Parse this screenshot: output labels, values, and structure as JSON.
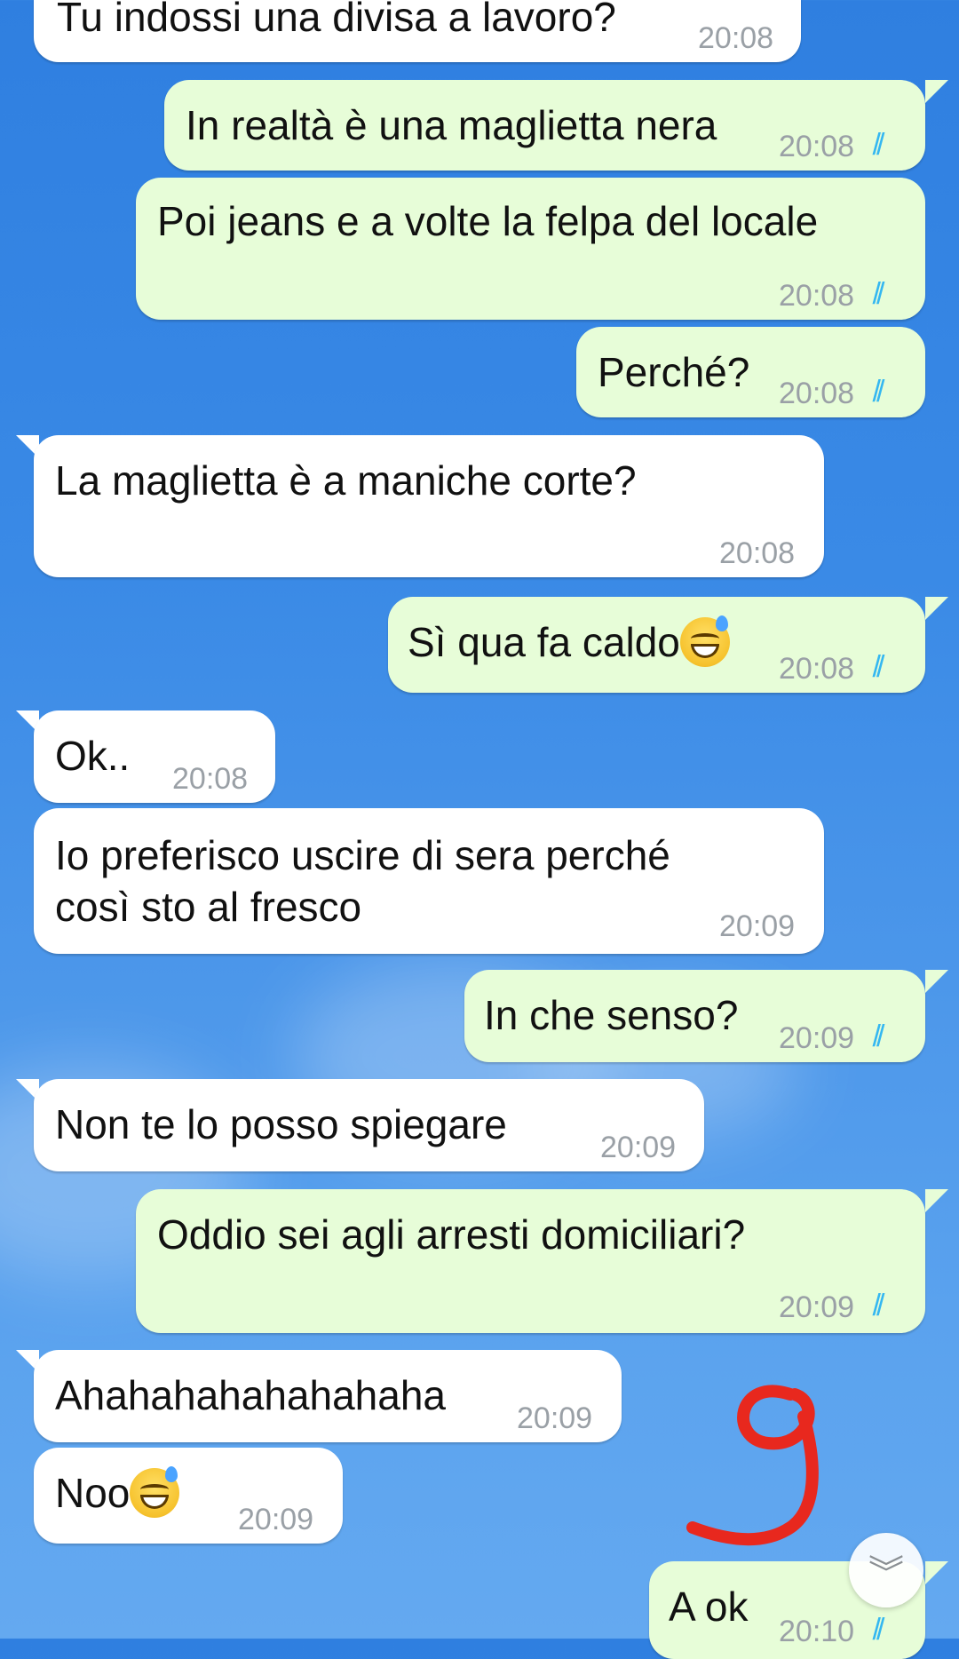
{
  "messages": [
    {
      "text": "Tu indossi una divisa a lavoro?",
      "time": "20:08",
      "dir": "in"
    },
    {
      "text": "In realtà è una maglietta nera",
      "time": "20:08",
      "dir": "out"
    },
    {
      "text": "Poi jeans e a volte la felpa del locale",
      "time": "20:08",
      "dir": "out"
    },
    {
      "text": "Perché?",
      "time": "20:08",
      "dir": "out"
    },
    {
      "text": "La maglietta è a maniche corte?",
      "time": "20:08",
      "dir": "in"
    },
    {
      "text": "Sì qua fa caldo",
      "time": "20:08",
      "dir": "out",
      "emoji": "grinning-sweat-emoji"
    },
    {
      "text": "Ok..",
      "time": "20:08",
      "dir": "in"
    },
    {
      "text_line1": "Io preferisco uscire di sera perché",
      "text_line2": "così sto al fresco",
      "time": "20:09",
      "dir": "in"
    },
    {
      "text": "In che senso?",
      "time": "20:09",
      "dir": "out"
    },
    {
      "text": "Non te lo posso spiegare",
      "time": "20:09",
      "dir": "in"
    },
    {
      "text": "Oddio sei agli arresti domiciliari?",
      "time": "20:09",
      "dir": "out"
    },
    {
      "text": "Ahahahahahahahaha",
      "time": "20:09",
      "dir": "in"
    },
    {
      "text": "Noo",
      "time": "20:09",
      "dir": "in",
      "emoji": "grinning-sweat-emoji"
    },
    {
      "text": "A ok",
      "time": "20:10",
      "dir": "out"
    }
  ],
  "read_ticks": "//",
  "colors": {
    "incoming": "#ffffff",
    "outgoing": "#e7fdd8",
    "ticks": "#34b7f1",
    "time": "#9aa0a6"
  },
  "icons": {
    "scroll_down": "double-chevron-down-icon"
  },
  "scroll_glyph": "︾"
}
